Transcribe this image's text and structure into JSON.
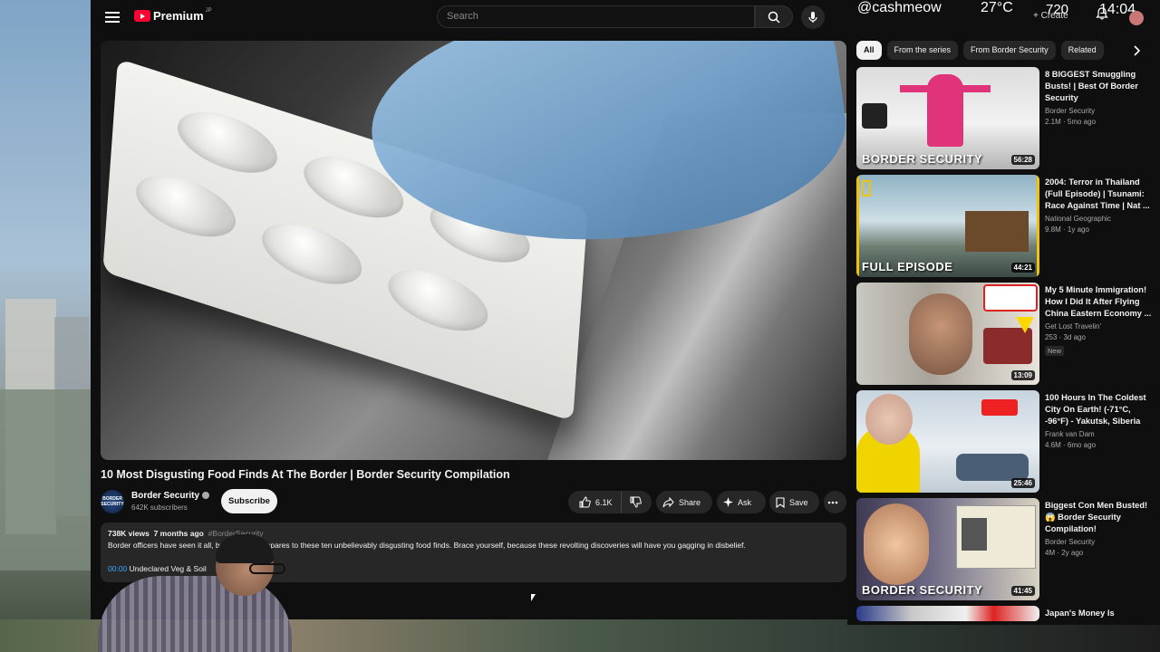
{
  "masthead": {
    "logo_text": "Premium",
    "logo_region": "JP",
    "search_placeholder": "Search"
  },
  "overlay": {
    "handle": "@cashmeow",
    "temperature": "27°C",
    "resolution": "720",
    "clock": "14:04",
    "create_label": "+ Create"
  },
  "video": {
    "title": "10 Most Disgusting Food Finds At The Border | Border Security Compilation",
    "channel": "Border Security",
    "avatar_text": "BORDER SECURITY",
    "subscribers": "642K subscribers",
    "subscribe_label": "Subscribe",
    "likes": "6.1K",
    "share_label": "Share",
    "ask_label": "Ask",
    "save_label": "Save"
  },
  "description": {
    "views": "738K views",
    "age": "7 months ago",
    "hashtag": "#BorderSecurity",
    "text": "Border officers have seen it all, but nothing compares to these ten unbelievably disgusting food finds. Brace yourself, because these revolting discoveries will have you gagging in disbelief.",
    "chapter_time": "00:00",
    "chapter_title": "Undeclared Veg & Soil"
  },
  "chips": [
    "All",
    "From the series",
    "From Border Security",
    "Related"
  ],
  "recommendations": [
    {
      "title": "8 BIGGEST Smuggling Busts! | Best Of Border Security",
      "channel": "Border Security",
      "stats": "2.1M · 5mo ago",
      "duration": "56:28",
      "thumb_label": "BORDER SECURITY",
      "badge": ""
    },
    {
      "title": "2004: Terror in Thailand (Full Episode) | Tsunami: Race Against Time | Nat ...",
      "channel": "National Geographic",
      "stats": "9.8M · 1y ago",
      "duration": "44:21",
      "thumb_label": "FULL EPISODE",
      "badge": ""
    },
    {
      "title": "My 5 Minute Immigration! How I Did It After Flying China Eastern Economy ...",
      "channel": "Get Lost Travelin'",
      "stats": "253 · 3d ago",
      "duration": "13:09",
      "thumb_label": "",
      "badge": "New"
    },
    {
      "title": "100 Hours In The Coldest City On Earth! (-71°C, -96°F) - Yakutsk, Siberia",
      "channel": "Frank van Dam",
      "stats": "4.6M · 6mo ago",
      "duration": "25:46",
      "thumb_label": "",
      "badge": ""
    },
    {
      "title": "Biggest Con Men Busted! 😱 Border Security Compilation!",
      "channel": "Border Security",
      "stats": "4M · 2y ago",
      "duration": "41:45",
      "thumb_label": "BORDER SECURITY",
      "badge": ""
    },
    {
      "title": "Japan's Money Is Collapsing",
      "channel": "",
      "stats": "",
      "duration": "",
      "thumb_label": "",
      "badge": ""
    }
  ]
}
